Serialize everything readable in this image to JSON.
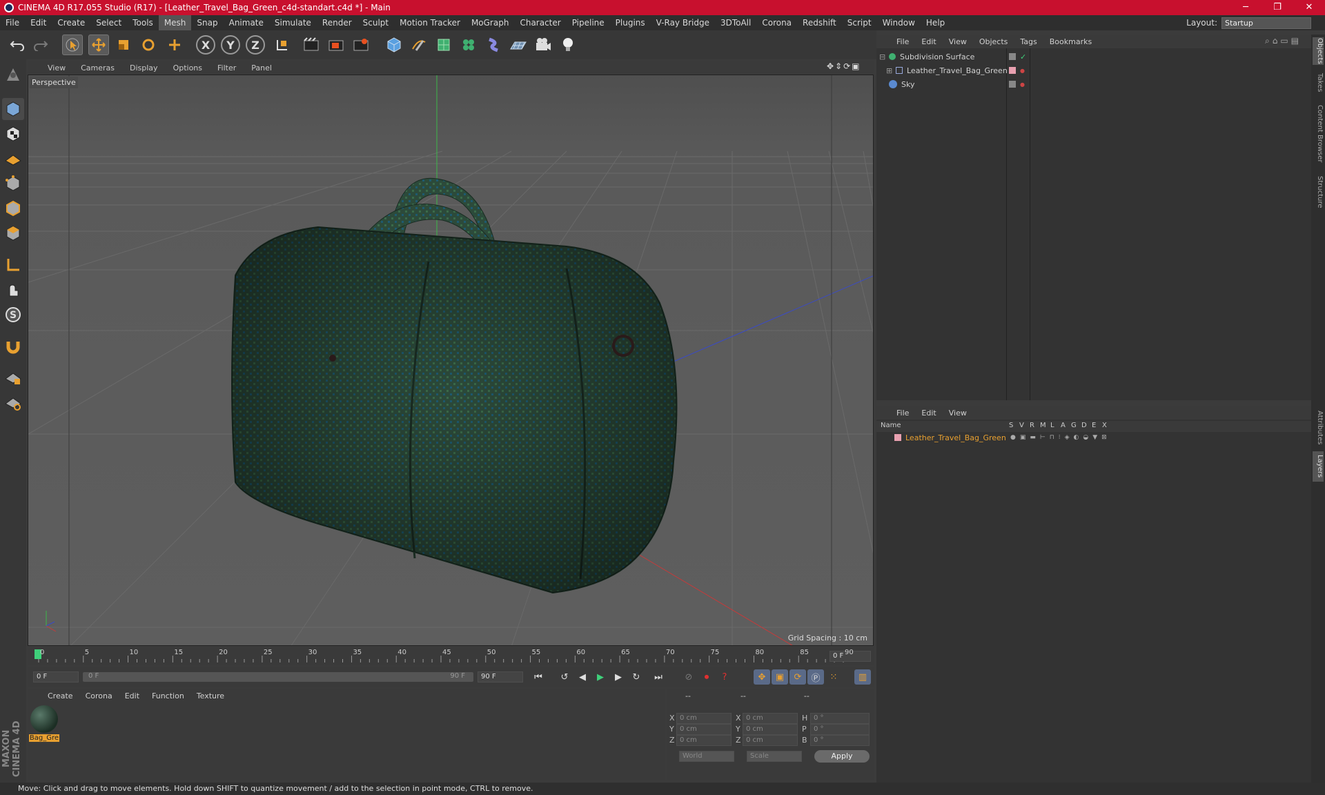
{
  "window": {
    "title": "CINEMA 4D R17.055 Studio (R17) - [Leather_Travel_Bag_Green_c4d-standart.c4d *] - Main",
    "minimize": "─",
    "maximize": "❐",
    "close": "✕"
  },
  "menubar": {
    "items": [
      "File",
      "Edit",
      "Create",
      "Select",
      "Tools",
      "Mesh",
      "Snap",
      "Animate",
      "Simulate",
      "Render",
      "Sculpt",
      "Motion Tracker",
      "MoGraph",
      "Character",
      "Pipeline",
      "Plugins",
      "V-Ray Bridge",
      "3DToAll",
      "Corona",
      "Redshift",
      "Script",
      "Window",
      "Help"
    ],
    "active": "Mesh",
    "layout_label": "Layout:",
    "layout_value": "Startup"
  },
  "toolbar": {
    "icons": [
      "undo-icon",
      "redo-icon",
      "select-arrow-icon",
      "move-icon",
      "scale-icon",
      "rotate-icon",
      "move-plus-icon",
      "x-axis-icon",
      "y-axis-icon",
      "z-axis-icon",
      "coord-system-icon",
      "render-view-icon",
      "render-picture-viewer-icon",
      "render-settings-icon",
      "cube-icon",
      "pen-icon",
      "subdivision-icon",
      "cloner-icon",
      "deformer-icon",
      "floor-icon",
      "camera-icon",
      "light-icon"
    ],
    "axis_labels": [
      "X",
      "Y",
      "Z"
    ]
  },
  "viewport": {
    "menu": [
      "View",
      "Cameras",
      "Display",
      "Options",
      "Filter",
      "Panel"
    ],
    "label": "Perspective",
    "grid_spacing": "Grid Spacing : 10 cm"
  },
  "timeline": {
    "ticks": [
      "0",
      "5",
      "10",
      "15",
      "20",
      "25",
      "30",
      "35",
      "40",
      "45",
      "50",
      "55",
      "60",
      "65",
      "70",
      "75",
      "80",
      "85",
      "90"
    ],
    "current_frame_box": "0 F",
    "start_frame": "0 F",
    "slider_left": "0 F",
    "slider_right": "90 F",
    "end_frame": "90 F"
  },
  "materials": {
    "menu": [
      "Create",
      "Corona",
      "Edit",
      "Function",
      "Texture"
    ],
    "items": [
      {
        "name": "Bag_Gre"
      }
    ]
  },
  "coordinates": {
    "header": [
      "--",
      "--",
      "--"
    ],
    "rows": [
      {
        "a": "X",
        "av": "0 cm",
        "b": "X",
        "bv": "0 cm",
        "c": "H",
        "cv": "0 °"
      },
      {
        "a": "Y",
        "av": "0 cm",
        "b": "Y",
        "bv": "0 cm",
        "c": "P",
        "cv": "0 °"
      },
      {
        "a": "Z",
        "av": "0 cm",
        "b": "Z",
        "bv": "0 cm",
        "c": "B",
        "cv": "0 °"
      }
    ],
    "mode1": "World",
    "mode2": "Scale",
    "apply": "Apply"
  },
  "object_manager": {
    "menu": [
      "File",
      "Edit",
      "View",
      "Objects",
      "Tags",
      "Bookmarks"
    ],
    "objects": [
      {
        "name": "Subdivision Surface"
      },
      {
        "name": "Leather_Travel_Bag_Green"
      },
      {
        "name": "Sky"
      }
    ]
  },
  "layer_manager": {
    "menu": [
      "File",
      "Edit",
      "View"
    ],
    "columns": [
      "Name",
      "S",
      "V",
      "R",
      "M",
      "L",
      "A",
      "G",
      "D",
      "E",
      "X"
    ],
    "layers": [
      {
        "name": "Leather_Travel_Bag_Green",
        "color": "#e8a030"
      }
    ]
  },
  "right_tabs": [
    "Objects",
    "Takes",
    "Content Browser",
    "Structure",
    "Attributes",
    "Layers"
  ],
  "brand": "MAXON CINEMA 4D",
  "status": "Move: Click and drag to move elements. Hold down SHIFT to quantize movement / add to the selection in point mode, CTRL to remove.",
  "colors": {
    "accent": "#e8a030",
    "titlebar": "#c8102e",
    "bag": "#2c4a3a"
  }
}
